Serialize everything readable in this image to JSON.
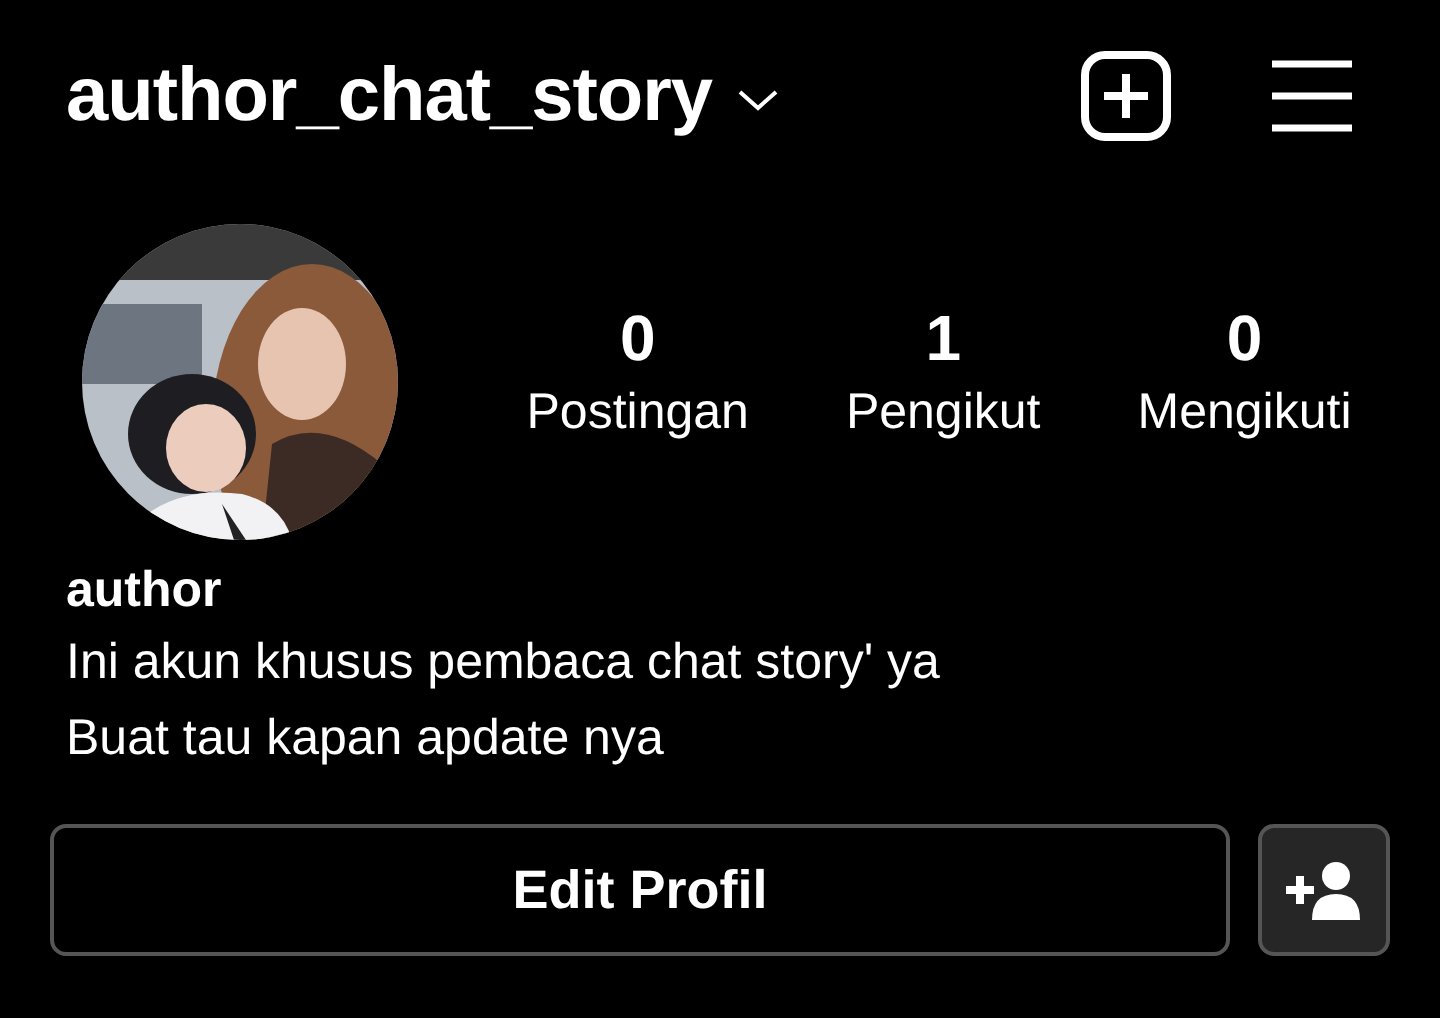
{
  "header": {
    "username": "author_chat_story"
  },
  "profile": {
    "avatar": {
      "kind": "picture"
    },
    "stats": [
      {
        "value": "0",
        "label": "Postingan"
      },
      {
        "value": "1",
        "label": "Pengikut"
      },
      {
        "value": "0",
        "label": "Mengikuti"
      }
    ],
    "name": "author",
    "bio": [
      "Ini akun khusus pembaca chat story' ya",
      "Buat tau kapan apdate nya"
    ]
  },
  "actions": {
    "edit_button": "Edit Profil"
  }
}
